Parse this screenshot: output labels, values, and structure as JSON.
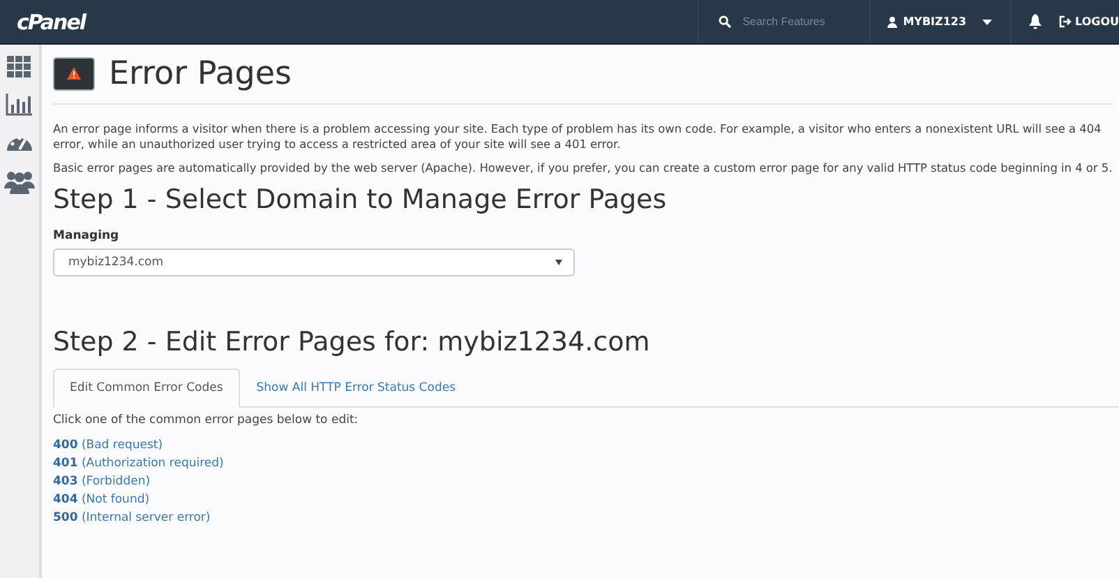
{
  "header": {
    "logo": "cPanel",
    "search": {
      "placeholder": "Search Features"
    },
    "user": "MYBIZ123",
    "logout": "LOGOU"
  },
  "sidebar": {
    "items": [
      {
        "kind": "grid"
      },
      {
        "kind": "chart"
      },
      {
        "kind": "gauge"
      },
      {
        "kind": "users"
      }
    ]
  },
  "page": {
    "title": "Error Pages",
    "intro": [
      "An error page informs a visitor when there is a problem accessing your site. Each type of problem has its own code. For example, a visitor who enters a nonexistent URL will see a 404 error, while an unauthorized user trying to access a restricted area of your site will see a 401 error.",
      "Basic error pages are automatically provided by the web server (Apache). However, if you prefer, you can create a custom error page for any valid HTTP status code beginning in 4 or 5."
    ],
    "step1": {
      "heading": "Step 1 - Select Domain to Manage Error Pages",
      "label": "Managing",
      "value": "mybiz1234.com"
    },
    "step2": {
      "heading": "Step 2 - Edit Error Pages for: mybiz1234.com",
      "tabs": [
        {
          "label": "Edit Common Error Codes",
          "selected": true
        },
        {
          "label": "Show All HTTP Error Status Codes",
          "selected": false
        }
      ],
      "instruction": "Click one of the common error pages below to edit:",
      "links": [
        {
          "code": "400",
          "description": "(Bad request)"
        },
        {
          "code": "401",
          "description": "(Authorization required)"
        },
        {
          "code": "403",
          "description": "(Forbidden)"
        },
        {
          "code": "404",
          "description": "(Not found)"
        },
        {
          "code": "500",
          "description": "(Internal server error)"
        }
      ]
    }
  }
}
